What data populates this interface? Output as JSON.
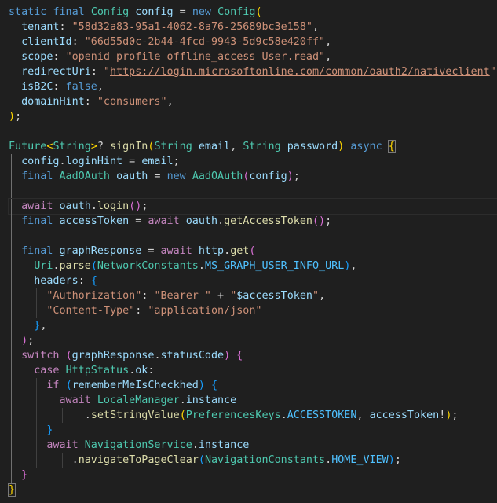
{
  "editor": {
    "language": "dart",
    "theme": "dark",
    "cursor": {
      "line": 11,
      "column": 23
    },
    "colors": {
      "background": "#1f1f1f",
      "keyword": "#569cd6",
      "control": "#c586c0",
      "type": "#4ec9b0",
      "variable": "#9cdcfe",
      "string": "#ce9178",
      "function": "#dcdcaa",
      "bracket_1": "#ffd700",
      "bracket_2": "#da70d6",
      "bracket_3": "#179fff"
    }
  },
  "lines": [
    {
      "n": 1,
      "guides": 0,
      "tokens": [
        [
          "kw",
          "static"
        ],
        [
          "p",
          " "
        ],
        [
          "kw",
          "final"
        ],
        [
          "p",
          " "
        ],
        [
          "type",
          "Config"
        ],
        [
          "p",
          " "
        ],
        [
          "var",
          "config"
        ],
        [
          "p",
          " = "
        ],
        [
          "kw",
          "new"
        ],
        [
          "p",
          " "
        ],
        [
          "type",
          "Config"
        ],
        [
          "b1",
          "("
        ]
      ]
    },
    {
      "n": 2,
      "guides": 0,
      "tokens": [
        [
          "p",
          "  "
        ],
        [
          "var",
          "tenant"
        ],
        [
          "p",
          ": "
        ],
        [
          "str",
          "\"58d32a83-95a1-4062-8a76-25689bc3e158\""
        ],
        [
          "p",
          ","
        ]
      ]
    },
    {
      "n": 3,
      "guides": 0,
      "tokens": [
        [
          "p",
          "  "
        ],
        [
          "var",
          "clientId"
        ],
        [
          "p",
          ": "
        ],
        [
          "str",
          "\"66d55d0c-2b44-4fcd-9943-5d9c58e420ff\""
        ],
        [
          "p",
          ","
        ]
      ]
    },
    {
      "n": 4,
      "guides": 0,
      "tokens": [
        [
          "p",
          "  "
        ],
        [
          "var",
          "scope"
        ],
        [
          "p",
          ": "
        ],
        [
          "str",
          "\"openid profile offline_access User.read\""
        ],
        [
          "p",
          ","
        ]
      ]
    },
    {
      "n": 5,
      "guides": 0,
      "tokens": [
        [
          "p",
          "  "
        ],
        [
          "var",
          "redirectUri"
        ],
        [
          "p",
          ": "
        ],
        [
          "str",
          "\""
        ],
        [
          "url",
          "https://login.microsoftonline.com/common/oauth2/nativeclient"
        ],
        [
          "str",
          "\""
        ],
        [
          "p",
          ","
        ]
      ]
    },
    {
      "n": 6,
      "guides": 0,
      "tokens": [
        [
          "p",
          "  "
        ],
        [
          "var",
          "isB2C"
        ],
        [
          "p",
          ": "
        ],
        [
          "kw",
          "false"
        ],
        [
          "p",
          ","
        ]
      ]
    },
    {
      "n": 7,
      "guides": 0,
      "tokens": [
        [
          "p",
          "  "
        ],
        [
          "var",
          "domainHint"
        ],
        [
          "p",
          ": "
        ],
        [
          "str",
          "\"consumers\""
        ],
        [
          "p",
          ","
        ]
      ]
    },
    {
      "n": 8,
      "guides": 0,
      "tokens": [
        [
          "b1",
          ")"
        ],
        [
          "p",
          ";"
        ]
      ]
    },
    {
      "n": 9,
      "guides": 0,
      "tokens": []
    },
    {
      "n": 10,
      "guides": 0,
      "tokens": [
        [
          "type",
          "Future"
        ],
        [
          "b1",
          "<"
        ],
        [
          "type",
          "String"
        ],
        [
          "b1",
          ">"
        ],
        [
          "p",
          "? "
        ],
        [
          "fn",
          "signIn"
        ],
        [
          "b1",
          "("
        ],
        [
          "type",
          "String"
        ],
        [
          "p",
          " "
        ],
        [
          "var",
          "email"
        ],
        [
          "p",
          ", "
        ],
        [
          "type",
          "String"
        ],
        [
          "p",
          " "
        ],
        [
          "var",
          "password"
        ],
        [
          "b1",
          ")"
        ],
        [
          "p",
          " "
        ],
        [
          "kw",
          "async"
        ],
        [
          "p",
          " "
        ],
        [
          "b1m",
          "{"
        ]
      ]
    },
    {
      "n": 11,
      "guides": 1,
      "tokens": [
        [
          "p",
          "  "
        ],
        [
          "var",
          "config"
        ],
        [
          "p",
          "."
        ],
        [
          "var",
          "loginHint"
        ],
        [
          "p",
          " = "
        ],
        [
          "var",
          "email"
        ],
        [
          "p",
          ";"
        ]
      ]
    },
    {
      "n": 12,
      "guides": 1,
      "tokens": [
        [
          "p",
          "  "
        ],
        [
          "kw",
          "final"
        ],
        [
          "p",
          " "
        ],
        [
          "type",
          "AadOAuth"
        ],
        [
          "p",
          " "
        ],
        [
          "var",
          "oauth"
        ],
        [
          "p",
          " = "
        ],
        [
          "kw",
          "new"
        ],
        [
          "p",
          " "
        ],
        [
          "type",
          "AadOAuth"
        ],
        [
          "b2",
          "("
        ],
        [
          "var",
          "config"
        ],
        [
          "b2",
          ")"
        ],
        [
          "p",
          ";"
        ]
      ]
    },
    {
      "n": 13,
      "guides": 1,
      "tokens": []
    },
    {
      "n": 14,
      "guides": 1,
      "current": true,
      "tokens": [
        [
          "p",
          "  "
        ],
        [
          "ctl",
          "await"
        ],
        [
          "p",
          " "
        ],
        [
          "var",
          "oauth"
        ],
        [
          "p",
          "."
        ],
        [
          "fn",
          "login"
        ],
        [
          "b2",
          "()"
        ],
        [
          "p",
          ";"
        ],
        [
          "caret",
          ""
        ]
      ]
    },
    {
      "n": 15,
      "guides": 1,
      "tokens": [
        [
          "p",
          "  "
        ],
        [
          "kw",
          "final"
        ],
        [
          "p",
          " "
        ],
        [
          "var",
          "accessToken"
        ],
        [
          "p",
          " = "
        ],
        [
          "ctl",
          "await"
        ],
        [
          "p",
          " "
        ],
        [
          "var",
          "oauth"
        ],
        [
          "p",
          "."
        ],
        [
          "fn",
          "getAccessToken"
        ],
        [
          "b2",
          "()"
        ],
        [
          "p",
          ";"
        ]
      ]
    },
    {
      "n": 16,
      "guides": 1,
      "tokens": []
    },
    {
      "n": 17,
      "guides": 1,
      "tokens": [
        [
          "p",
          "  "
        ],
        [
          "kw",
          "final"
        ],
        [
          "p",
          " "
        ],
        [
          "var",
          "graphResponse"
        ],
        [
          "p",
          " = "
        ],
        [
          "ctl",
          "await"
        ],
        [
          "p",
          " "
        ],
        [
          "var",
          "http"
        ],
        [
          "p",
          "."
        ],
        [
          "fn",
          "get"
        ],
        [
          "b2",
          "("
        ]
      ]
    },
    {
      "n": 18,
      "guides": 2,
      "tokens": [
        [
          "p",
          "    "
        ],
        [
          "type",
          "Uri"
        ],
        [
          "p",
          "."
        ],
        [
          "fn",
          "parse"
        ],
        [
          "b3",
          "("
        ],
        [
          "type",
          "NetworkConstants"
        ],
        [
          "p",
          "."
        ],
        [
          "const",
          "MS_GRAPH_USER_INFO_URL"
        ],
        [
          "b3",
          ")"
        ],
        [
          "p",
          ","
        ]
      ]
    },
    {
      "n": 19,
      "guides": 2,
      "tokens": [
        [
          "p",
          "    "
        ],
        [
          "var",
          "headers"
        ],
        [
          "p",
          ": "
        ],
        [
          "b3",
          "{"
        ]
      ]
    },
    {
      "n": 20,
      "guides": 3,
      "tokens": [
        [
          "p",
          "      "
        ],
        [
          "str",
          "\"Authorization\""
        ],
        [
          "p",
          ": "
        ],
        [
          "str",
          "\"Bearer \""
        ],
        [
          "p",
          " + "
        ],
        [
          "str",
          "\""
        ],
        [
          "var",
          "$accessToken"
        ],
        [
          "str",
          "\""
        ],
        [
          "p",
          ","
        ]
      ]
    },
    {
      "n": 21,
      "guides": 3,
      "tokens": [
        [
          "p",
          "      "
        ],
        [
          "str",
          "\"Content-Type\""
        ],
        [
          "p",
          ": "
        ],
        [
          "str",
          "\"application/json\""
        ]
      ]
    },
    {
      "n": 22,
      "guides": 2,
      "tokens": [
        [
          "p",
          "    "
        ],
        [
          "b3",
          "}"
        ],
        [
          "p",
          ","
        ]
      ]
    },
    {
      "n": 23,
      "guides": 1,
      "tokens": [
        [
          "p",
          "  "
        ],
        [
          "b2",
          ")"
        ],
        [
          "p",
          ";"
        ]
      ]
    },
    {
      "n": 24,
      "guides": 1,
      "tokens": [
        [
          "p",
          "  "
        ],
        [
          "ctl",
          "switch"
        ],
        [
          "p",
          " "
        ],
        [
          "b2",
          "("
        ],
        [
          "var",
          "graphResponse"
        ],
        [
          "p",
          "."
        ],
        [
          "var",
          "statusCode"
        ],
        [
          "b2",
          ")"
        ],
        [
          "p",
          " "
        ],
        [
          "b2",
          "{"
        ]
      ]
    },
    {
      "n": 25,
      "guides": 2,
      "tokens": [
        [
          "p",
          "    "
        ],
        [
          "ctl",
          "case"
        ],
        [
          "p",
          " "
        ],
        [
          "type",
          "HttpStatus"
        ],
        [
          "p",
          "."
        ],
        [
          "var",
          "ok"
        ],
        [
          "p",
          ":"
        ]
      ]
    },
    {
      "n": 26,
      "guides": 3,
      "tokens": [
        [
          "p",
          "      "
        ],
        [
          "ctl",
          "if"
        ],
        [
          "p",
          " "
        ],
        [
          "b3",
          "("
        ],
        [
          "var",
          "rememberMeIsCheckhed"
        ],
        [
          "b3",
          ")"
        ],
        [
          "p",
          " "
        ],
        [
          "b3",
          "{"
        ]
      ]
    },
    {
      "n": 27,
      "guides": 4,
      "tokens": [
        [
          "p",
          "        "
        ],
        [
          "ctl",
          "await"
        ],
        [
          "p",
          " "
        ],
        [
          "type",
          "LocaleManager"
        ],
        [
          "p",
          "."
        ],
        [
          "var",
          "instance"
        ]
      ]
    },
    {
      "n": 28,
      "guides": 6,
      "tokens": [
        [
          "p",
          "            ."
        ],
        [
          "fn",
          "setStringValue"
        ],
        [
          "b1",
          "("
        ],
        [
          "type",
          "PreferencesKeys"
        ],
        [
          "p",
          "."
        ],
        [
          "const",
          "ACCESSTOKEN"
        ],
        [
          "p",
          ", "
        ],
        [
          "var",
          "accessToken"
        ],
        [
          "p",
          "!"
        ],
        [
          "b1",
          ")"
        ],
        [
          "p",
          ";"
        ]
      ]
    },
    {
      "n": 29,
      "guides": 3,
      "tokens": [
        [
          "p",
          "      "
        ],
        [
          "b3",
          "}"
        ]
      ]
    },
    {
      "n": 30,
      "guides": 3,
      "tokens": [
        [
          "p",
          "      "
        ],
        [
          "ctl",
          "await"
        ],
        [
          "p",
          " "
        ],
        [
          "type",
          "NavigationService"
        ],
        [
          "p",
          "."
        ],
        [
          "var",
          "instance"
        ]
      ]
    },
    {
      "n": 31,
      "guides": 5,
      "tokens": [
        [
          "p",
          "          ."
        ],
        [
          "fn",
          "navigateToPageClear"
        ],
        [
          "b3",
          "("
        ],
        [
          "type",
          "NavigationConstants"
        ],
        [
          "p",
          "."
        ],
        [
          "const",
          "HOME_VIEW"
        ],
        [
          "b3",
          ")"
        ],
        [
          "p",
          ";"
        ]
      ]
    },
    {
      "n": 32,
      "guides": 1,
      "tokens": [
        [
          "p",
          "  "
        ],
        [
          "b2",
          "}"
        ]
      ]
    },
    {
      "n": 33,
      "guides": 0,
      "tokens": [
        [
          "b1m",
          "}"
        ]
      ]
    }
  ]
}
